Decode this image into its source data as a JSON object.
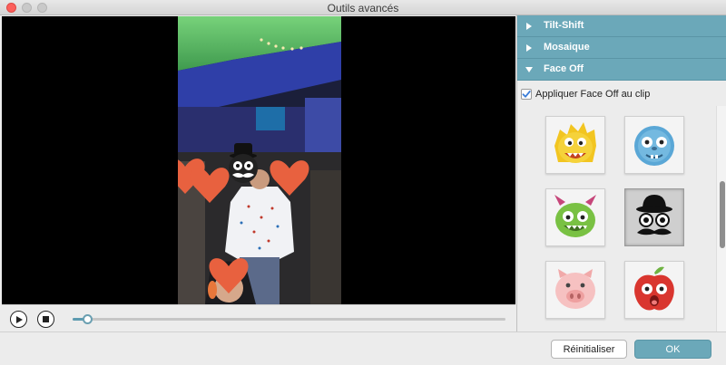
{
  "window": {
    "title": "Outils avancés"
  },
  "player": {
    "progress": 0.03
  },
  "sections": [
    {
      "label": "Tilt-Shift",
      "expanded": false
    },
    {
      "label": "Mosaique",
      "expanded": false
    },
    {
      "label": "Face Off",
      "expanded": true
    }
  ],
  "face_off": {
    "apply_label": "Appliquer Face Off au clip",
    "apply_checked": true,
    "masks": [
      {
        "icon": "yellow-furry-monster-icon",
        "selected": false
      },
      {
        "icon": "blue-furry-monster-icon",
        "selected": false
      },
      {
        "icon": "green-horned-monster-icon",
        "selected": false
      },
      {
        "icon": "bowler-hat-mustache-icon",
        "selected": true
      },
      {
        "icon": "pig-face-icon",
        "selected": false
      },
      {
        "icon": "apple-face-icon",
        "selected": false
      }
    ]
  },
  "buttons": {
    "reset_label": "Réinitialiser",
    "ok_label": "OK"
  },
  "colors": {
    "accent": "#6ba8b9",
    "heart": "#e8613f"
  }
}
